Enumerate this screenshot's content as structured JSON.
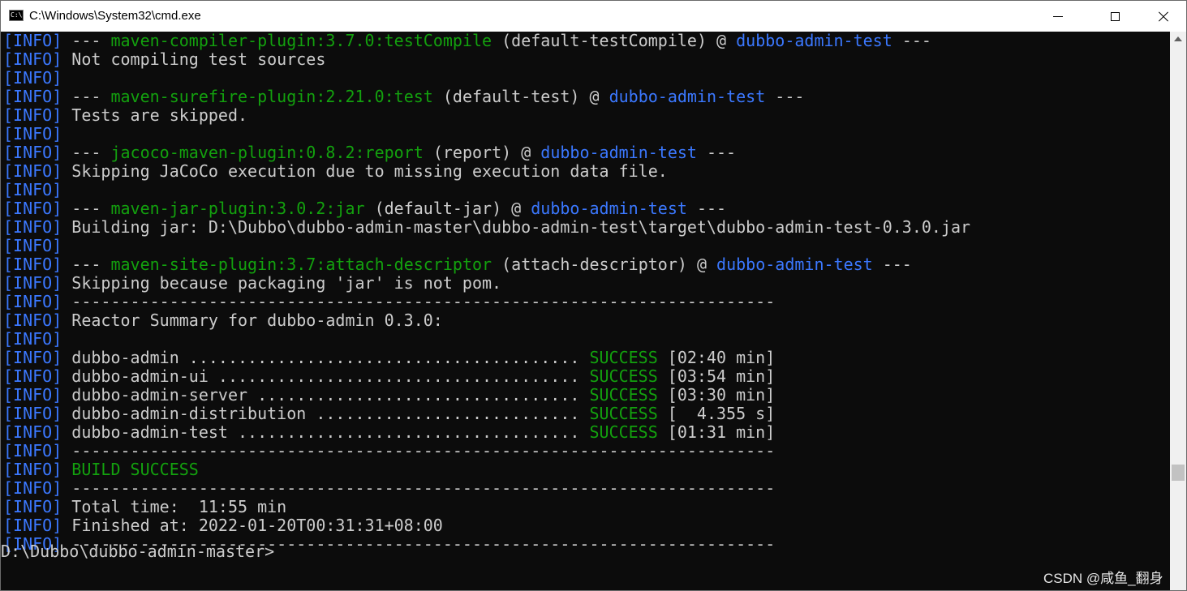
{
  "window": {
    "title": "C:\\Windows\\System32\\cmd.exe"
  },
  "console": {
    "lines": [
      [
        [
          "[INFO]",
          "info"
        ],
        [
          " --- ",
          "t"
        ],
        [
          "maven-compiler-plugin:3.7.0:testCompile",
          "plugin"
        ],
        [
          " (default-testCompile) @ ",
          "t"
        ],
        [
          "dubbo-admin-test",
          "artifact"
        ],
        [
          " ---",
          "t"
        ]
      ],
      [
        [
          "[INFO]",
          "info"
        ],
        [
          " Not compiling test sources",
          "t"
        ]
      ],
      [
        [
          "[INFO]",
          "info"
        ]
      ],
      [
        [
          "[INFO]",
          "info"
        ],
        [
          " --- ",
          "t"
        ],
        [
          "maven-surefire-plugin:2.21.0:test",
          "plugin"
        ],
        [
          " (default-test) @ ",
          "t"
        ],
        [
          "dubbo-admin-test",
          "artifact"
        ],
        [
          " ---",
          "t"
        ]
      ],
      [
        [
          "[INFO]",
          "info"
        ],
        [
          " Tests are skipped.",
          "t"
        ]
      ],
      [
        [
          "[INFO]",
          "info"
        ]
      ],
      [
        [
          "[INFO]",
          "info"
        ],
        [
          " --- ",
          "t"
        ],
        [
          "jacoco-maven-plugin:0.8.2:report",
          "plugin"
        ],
        [
          " (report) @ ",
          "t"
        ],
        [
          "dubbo-admin-test",
          "artifact"
        ],
        [
          " ---",
          "t"
        ]
      ],
      [
        [
          "[INFO]",
          "info"
        ],
        [
          " Skipping JaCoCo execution due to missing execution data file.",
          "t"
        ]
      ],
      [
        [
          "[INFO]",
          "info"
        ]
      ],
      [
        [
          "[INFO]",
          "info"
        ],
        [
          " --- ",
          "t"
        ],
        [
          "maven-jar-plugin:3.0.2:jar",
          "plugin"
        ],
        [
          " (default-jar) @ ",
          "t"
        ],
        [
          "dubbo-admin-test",
          "artifact"
        ],
        [
          " ---",
          "t"
        ]
      ],
      [
        [
          "[INFO]",
          "info"
        ],
        [
          " Building jar: D:\\Dubbo\\dubbo-admin-master\\dubbo-admin-test\\target\\dubbo-admin-test-0.3.0.jar",
          "t"
        ]
      ],
      [
        [
          "[INFO]",
          "info"
        ]
      ],
      [
        [
          "[INFO]",
          "info"
        ],
        [
          " --- ",
          "t"
        ],
        [
          "maven-site-plugin:3.7:attach-descriptor",
          "plugin"
        ],
        [
          " (attach-descriptor) @ ",
          "t"
        ],
        [
          "dubbo-admin-test",
          "artifact"
        ],
        [
          " ---",
          "t"
        ]
      ],
      [
        [
          "[INFO]",
          "info"
        ],
        [
          " Skipping because packaging 'jar' is not pom.",
          "t"
        ]
      ],
      [
        [
          "[INFO]",
          "info"
        ],
        [
          " ------------------------------------------------------------------------",
          "t"
        ]
      ],
      [
        [
          "[INFO]",
          "info"
        ],
        [
          " Reactor Summary for dubbo-admin 0.3.0:",
          "t"
        ]
      ],
      [
        [
          "[INFO]",
          "info"
        ]
      ],
      [
        [
          "[INFO]",
          "info"
        ],
        [
          " dubbo-admin ........................................ ",
          "t"
        ],
        [
          "SUCCESS",
          "ok"
        ],
        [
          " [02:40 min]",
          "t"
        ]
      ],
      [
        [
          "[INFO]",
          "info"
        ],
        [
          " dubbo-admin-ui ..................................... ",
          "t"
        ],
        [
          "SUCCESS",
          "ok"
        ],
        [
          " [03:54 min]",
          "t"
        ]
      ],
      [
        [
          "[INFO]",
          "info"
        ],
        [
          " dubbo-admin-server ................................. ",
          "t"
        ],
        [
          "SUCCESS",
          "ok"
        ],
        [
          " [03:30 min]",
          "t"
        ]
      ],
      [
        [
          "[INFO]",
          "info"
        ],
        [
          " dubbo-admin-distribution ........................... ",
          "t"
        ],
        [
          "SUCCESS",
          "ok"
        ],
        [
          " [  4.355 s]",
          "t"
        ]
      ],
      [
        [
          "[INFO]",
          "info"
        ],
        [
          " dubbo-admin-test ................................... ",
          "t"
        ],
        [
          "SUCCESS",
          "ok"
        ],
        [
          " [01:31 min]",
          "t"
        ]
      ],
      [
        [
          "[INFO]",
          "info"
        ],
        [
          " ------------------------------------------------------------------------",
          "t"
        ]
      ],
      [
        [
          "[INFO]",
          "info"
        ],
        [
          " ",
          "t"
        ],
        [
          "BUILD SUCCESS",
          "ok"
        ]
      ],
      [
        [
          "[INFO]",
          "info"
        ],
        [
          " ------------------------------------------------------------------------",
          "t"
        ]
      ],
      [
        [
          "[INFO]",
          "info"
        ],
        [
          " Total time:  11:55 min",
          "t"
        ]
      ],
      [
        [
          "[INFO]",
          "info"
        ],
        [
          " Finished at: 2022-01-20T00:31:31+08:00",
          "t"
        ]
      ],
      [
        [
          "[INFO]",
          "info"
        ],
        [
          " ------------------------------------------------------------------------",
          "t"
        ]
      ],
      [
        [
          "",
          "t"
        ]
      ]
    ],
    "prompt": "D:\\Dubbo\\dubbo-admin-master>"
  },
  "watermark": "CSDN @咸鱼_翻身",
  "colors": {
    "info": "#3b78ff",
    "plugin": "#13a10e",
    "artifact": "#3b78ff",
    "success": "#13a10e",
    "text": "#cccccc",
    "background": "#0c0c0c"
  },
  "icons": {
    "app": "cmd-icon",
    "minimize": "minimize-icon",
    "maximize": "maximize-icon",
    "close": "close-icon",
    "scroll_up": "scroll-up-arrow-icon"
  }
}
